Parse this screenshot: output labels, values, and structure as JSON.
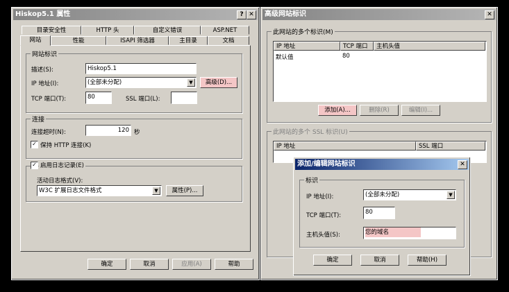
{
  "props": {
    "title": "Hiskop5.1 属性",
    "help_btn": "?",
    "close_btn": "✕",
    "tabs_row1": [
      "目录安全性",
      "HTTP 头",
      "自定义错误",
      "ASP.NET"
    ],
    "tabs_row2": [
      "网站",
      "性能",
      "ISAPI 筛选器",
      "主目录",
      "文档"
    ],
    "site_id_group": "网站标识",
    "desc_label": "描述(S):",
    "desc_value": "Hiskop5.1",
    "ip_label": "IP 地址(I):",
    "ip_value": "(全部未分配)",
    "advanced_btn": "高级(D)...",
    "tcp_label": "TCP 端口(T):",
    "tcp_value": "80",
    "ssl_label": "SSL 端口(L):",
    "ssl_value": "",
    "conn_group": "连接",
    "timeout_label": "连接超时(N):",
    "timeout_value": "120",
    "timeout_unit": "秒",
    "keepalive_label": "保持 HTTP 连接(K)",
    "logging_label": "启用日志记录(E)",
    "log_format_label": "活动日志格式(V):",
    "log_format_value": "W3C 扩展日志文件格式",
    "log_props_btn": "属性(P)...",
    "ok_btn": "确定",
    "cancel_btn": "取消",
    "apply_btn": "应用(A)",
    "help2_btn": "帮助"
  },
  "advanced": {
    "title": "高级网站标识",
    "close_btn": "✕",
    "multi_id_label": "此网站的多个标识(M)",
    "cols": [
      "IP 地址",
      "TCP 端口",
      "主机头值"
    ],
    "rows": [
      {
        "ip": "默认值",
        "port": "80",
        "host": ""
      }
    ],
    "add_btn": "添加(A)...",
    "remove_btn": "删除(R)",
    "edit_btn": "编辑(I)...",
    "ssl_label": "此网站的多个 SSL 标识(U)",
    "ssl_cols": [
      "IP 地址",
      "SSL 端口"
    ]
  },
  "edit": {
    "title": "添加/编辑网站标识",
    "close_btn": "✕",
    "group": "标识",
    "ip_label": "IP 地址(I):",
    "ip_value": "(全部未分配)",
    "tcp_label": "TCP 端口(T):",
    "tcp_value": "80",
    "host_label": "主机头值(S):",
    "host_value": "您的域名",
    "ok_btn": "确定",
    "cancel_btn": "取消",
    "help_btn": "帮助(H)"
  }
}
